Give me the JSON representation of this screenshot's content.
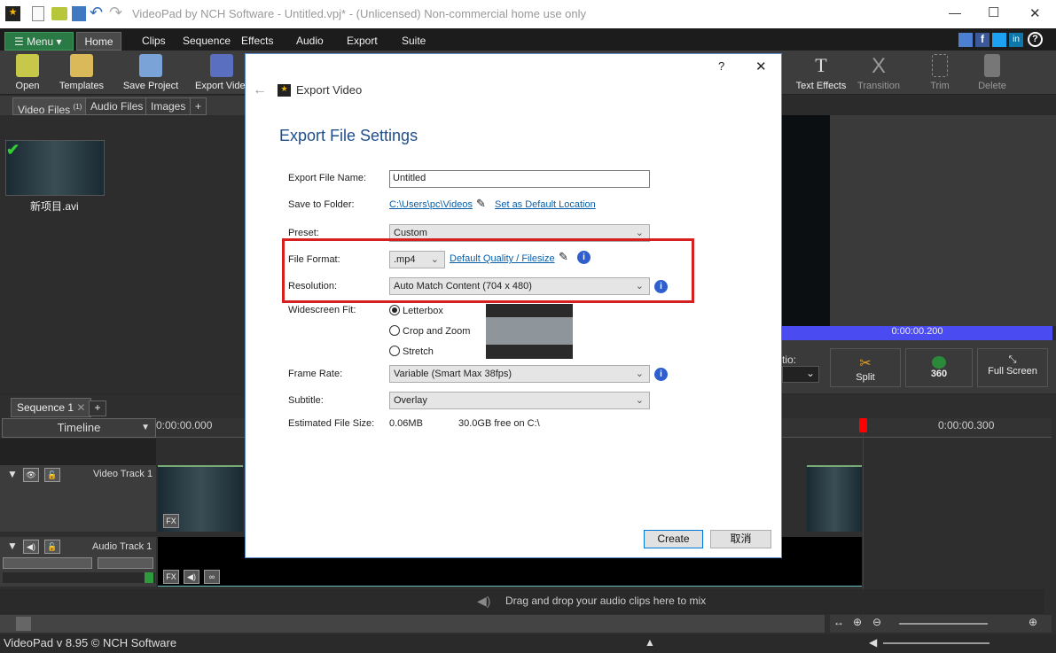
{
  "window": {
    "title": "VideoPad by NCH Software - Untitled.vpj* - (Unlicensed) Non-commercial home use only",
    "min": "—",
    "max": "☐",
    "close": "✕"
  },
  "menubar": {
    "menu_label": "Menu",
    "tabs": [
      "Home",
      "Clips",
      "Sequence",
      "Effects",
      "Audio",
      "Export",
      "Suite"
    ]
  },
  "toolbar": {
    "left": [
      "Open",
      "Templates",
      "Save Project",
      "Export Video"
    ],
    "right": [
      "Text Effects",
      "Transition",
      "Trim",
      "Delete"
    ]
  },
  "bin": {
    "tabs": [
      "Video Files",
      "Audio Files",
      "Images",
      "+"
    ],
    "video_count": "(1)",
    "file_name": "新项目.avi"
  },
  "dialog": {
    "title": "Export Video",
    "help": "?",
    "close": "✕",
    "heading": "Export File Settings",
    "labels": {
      "name": "Export File Name:",
      "folder": "Save to Folder:",
      "preset": "Preset:",
      "format": "File Format:",
      "resolution": "Resolution:",
      "widescreen": "Widescreen Fit:",
      "framerate": "Frame Rate:",
      "subtitle": "Subtitle:",
      "size": "Estimated File Size:"
    },
    "file_name": "Untitled",
    "folder": "C:\\Users\\pc\\Videos",
    "default_location": "Set as Default Location",
    "preset": "Custom",
    "format": ".mp4",
    "quality_link": "Default Quality / Filesize",
    "resolution": "Auto Match Content (704 x 480)",
    "widescreen_options": [
      "Letterbox",
      "Crop and Zoom",
      "Stretch"
    ],
    "widescreen_selected": "Letterbox",
    "framerate": "Variable (Smart Max 38fps)",
    "subtitle": "Overlay",
    "file_size": "0.06MB",
    "free_space": "30.0GB free on C:\\",
    "create": "Create",
    "cancel": "取消"
  },
  "preview": {
    "time": "0:00:00.200",
    "ratio_label": "tio:",
    "split": "Split",
    "btn360": "360",
    "fullscreen": "Full Screen"
  },
  "timeline": {
    "sequence_tab": "Sequence 1",
    "add": "+",
    "mode": "Timeline",
    "start_time": "0:00:00.000",
    "time_300": "0:00:00.300",
    "video_track": "Video Track 1",
    "audio_track": "Audio Track 1",
    "fx": "FX",
    "drop_hint": "Drag and drop your audio clips here to mix"
  },
  "status": {
    "text": "VideoPad v 8.95 © NCH Software"
  }
}
